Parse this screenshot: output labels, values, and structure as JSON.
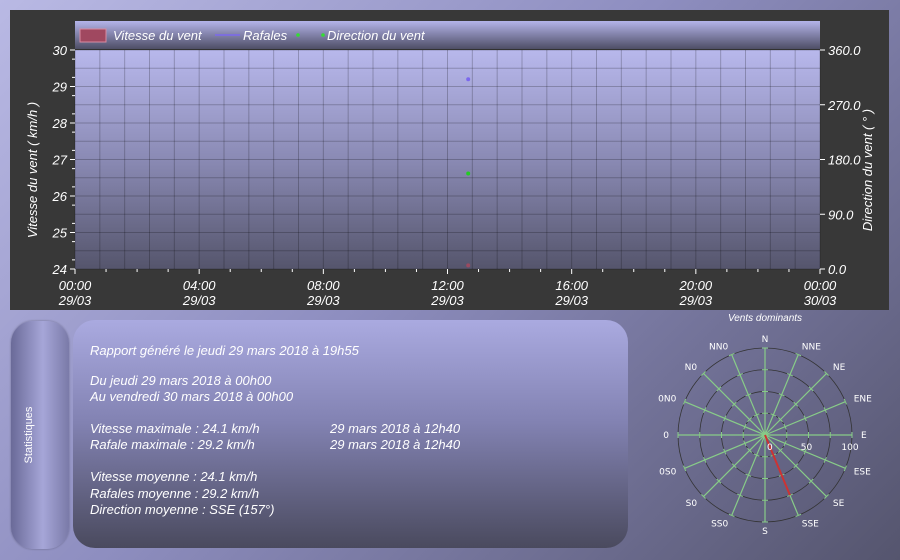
{
  "chart_data": [
    {
      "type": "line",
      "legend": {
        "placement": "top",
        "items": [
          "Vitesse du vent",
          "Rafales",
          "Direction du vent"
        ]
      },
      "ylabel_left": "Vitesse du vent ( km/h )",
      "ylabel_right": "Direction du vent ( ° )",
      "ylim_left": [
        24,
        30
      ],
      "ylim_right": [
        0,
        360
      ],
      "y_left_ticks": [
        "24",
        "25",
        "26",
        "27",
        "28",
        "29",
        "30"
      ],
      "y_right_ticks": [
        "0.0",
        "90.0",
        "180.0",
        "270.0",
        "360.0"
      ],
      "x_tick_times": [
        "00:00",
        "04:00",
        "08:00",
        "12:00",
        "16:00",
        "20:00",
        "00:00"
      ],
      "x_tick_dates": [
        "29/03",
        "29/03",
        "29/03",
        "29/03",
        "29/03",
        "29/03",
        "30/03"
      ],
      "x_range_hours": [
        0,
        24
      ],
      "series": [
        {
          "name": "Vitesse du vent",
          "color": "#9a4a60",
          "points": [
            {
              "x": "12:40",
              "y": 24.1
            }
          ]
        },
        {
          "name": "Rafales",
          "color": "#7b68ee",
          "points": [
            {
              "x": "12:40",
              "y": 29.2
            }
          ]
        },
        {
          "name": "Direction du vent",
          "color": "#22cc22",
          "axis": "right",
          "points": [
            {
              "x": "12:40",
              "y": 157
            }
          ]
        }
      ],
      "grid": true
    },
    {
      "type": "polar",
      "title": "Vents dominants",
      "directions": [
        "N",
        "NNE",
        "NE",
        "ENE",
        "E",
        "ESE",
        "SE",
        "SSE",
        "S",
        "SS0",
        "S0",
        "0S0",
        "0",
        "0N0",
        "N0",
        "NN0"
      ],
      "radial_labels": [
        "0",
        "50",
        "100"
      ],
      "values": [
        {
          "direction": "SSE",
          "value": 75
        }
      ],
      "bar_color": "#cc3333",
      "spoke_color": "#88cc88"
    }
  ],
  "stats": {
    "tab_label": "Statistiques",
    "generated": "Rapport généré le jeudi 29 mars 2018 à 19h55",
    "from": "Du jeudi 29 mars 2018 à 00h00",
    "to": "Au vendredi 30 mars 2018 à 00h00",
    "max_speed": "Vitesse maximale : 24.1 km/h",
    "max_speed_time": "29 mars 2018 à 12h40",
    "max_gust": "Rafale maximale : 29.2 km/h",
    "max_gust_time": "29 mars 2018 à 12h40",
    "avg_speed": "Vitesse moyenne : 24.1 km/h",
    "avg_gust": "Rafales moyenne : 29.2 km/h",
    "avg_dir": "Direction moyenne : SSE (157°)"
  }
}
